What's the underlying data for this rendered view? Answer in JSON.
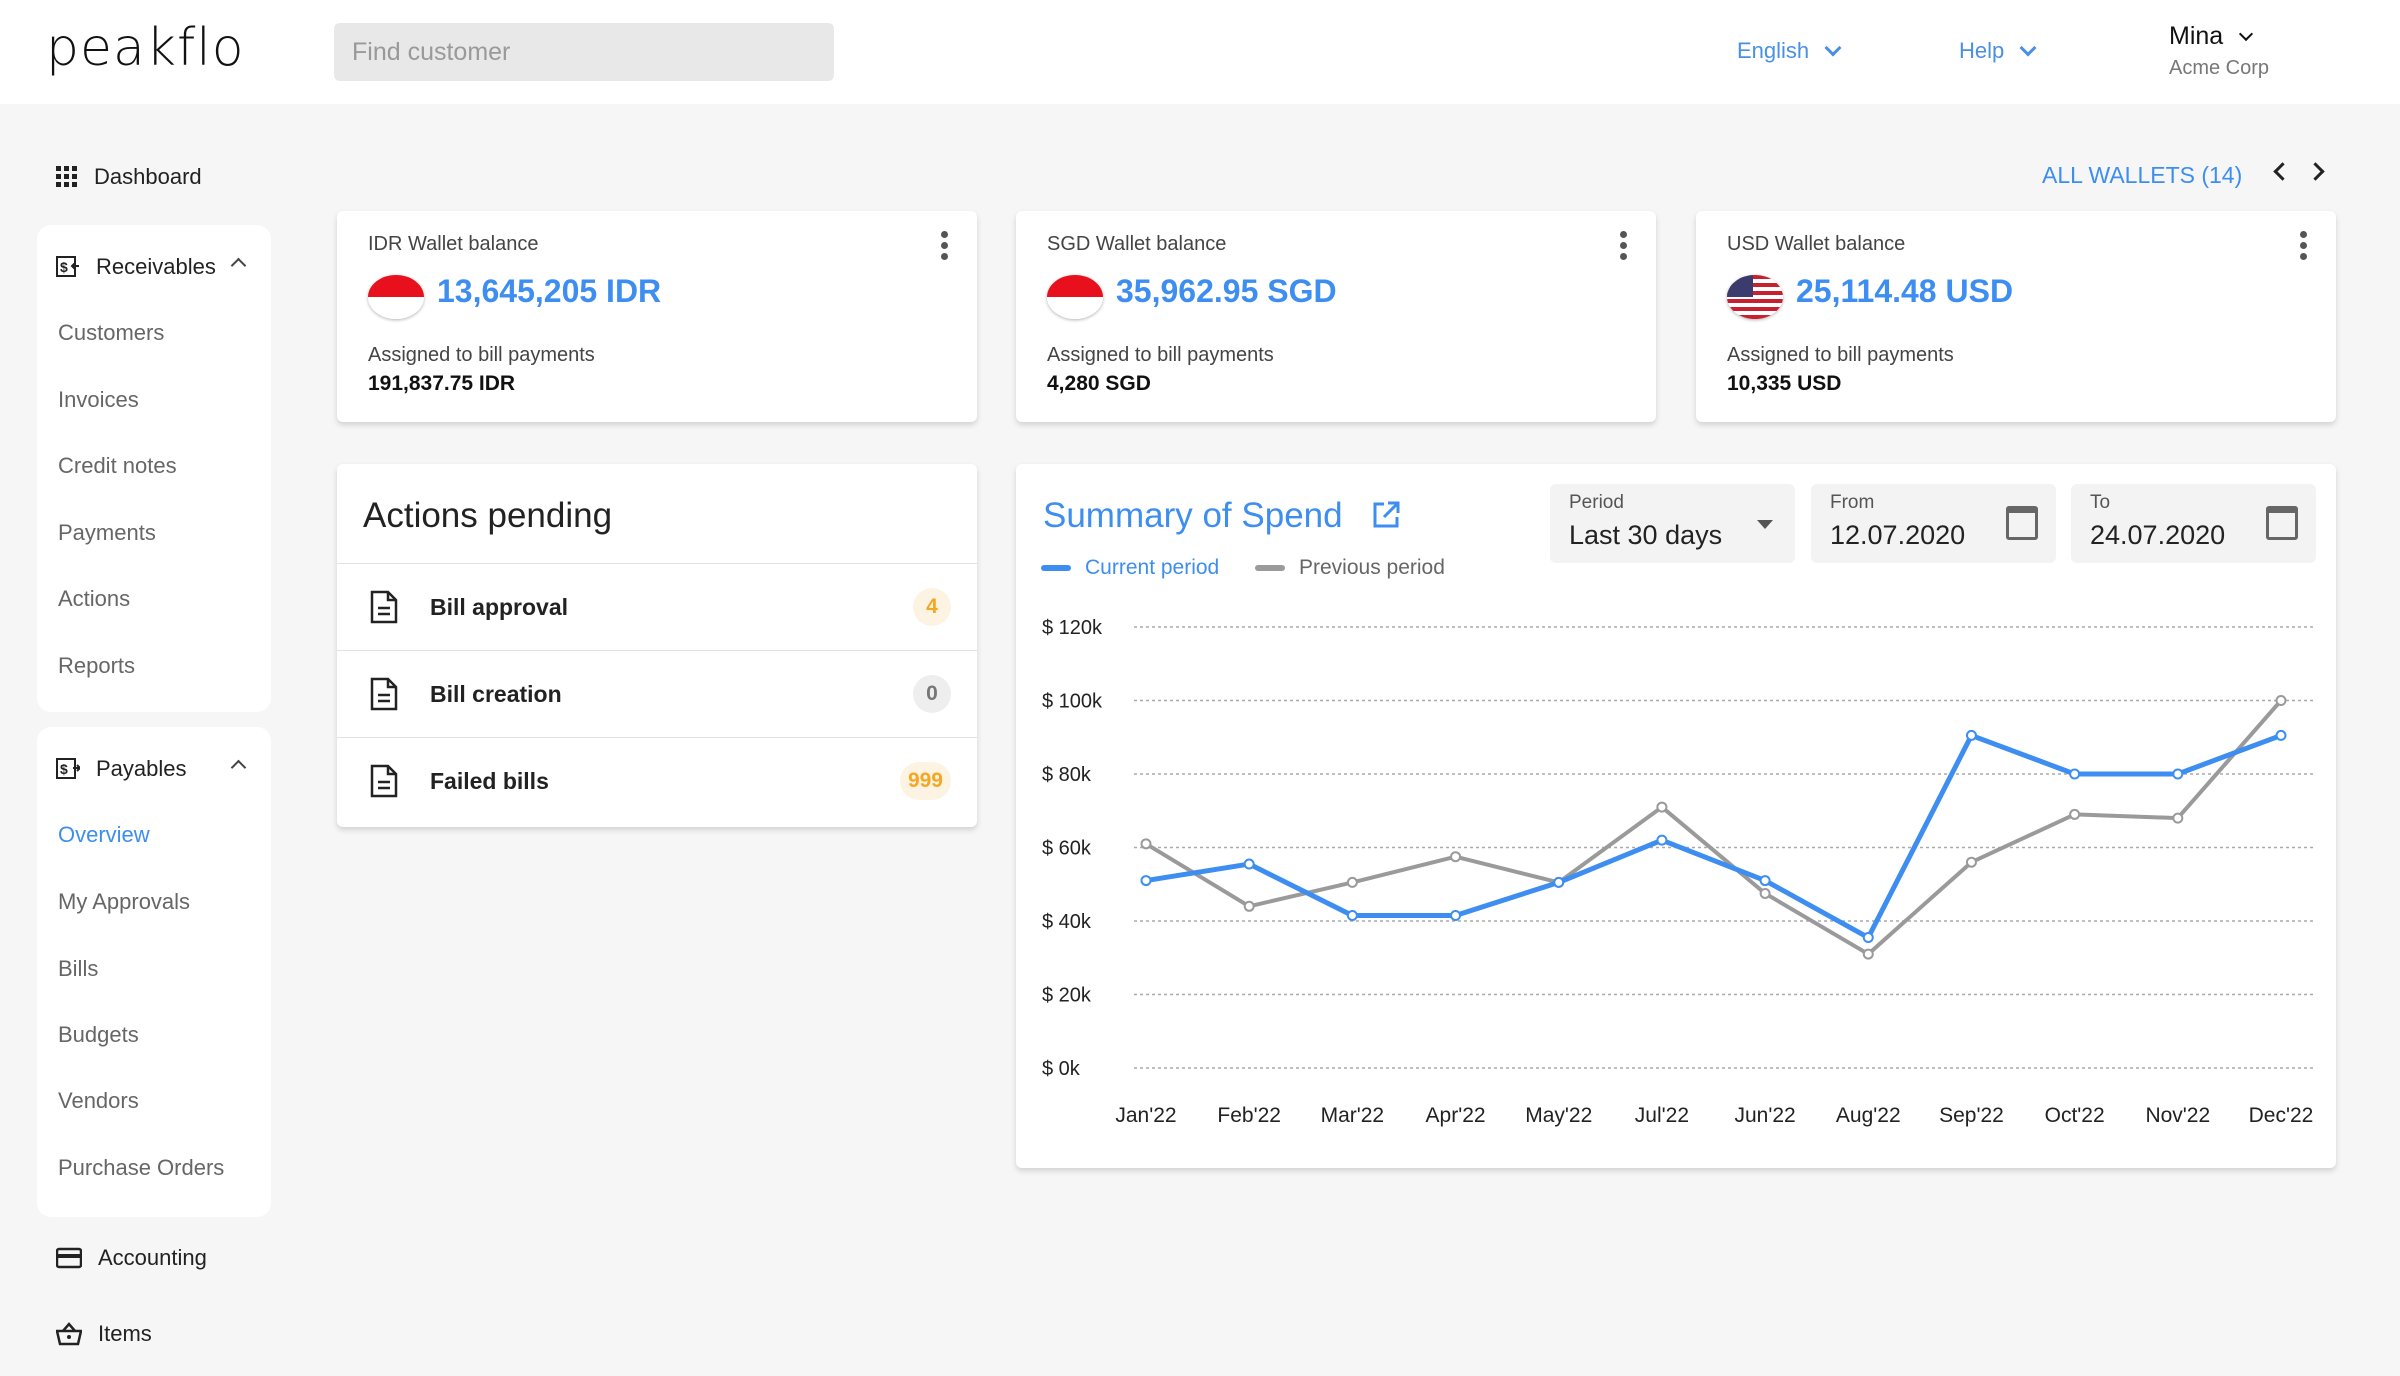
{
  "header": {
    "logo": "peakflo",
    "search_placeholder": "Find customer",
    "language": "English",
    "help": "Help",
    "user_name": "Mina",
    "company": "Acme Corp"
  },
  "sidebar": {
    "dashboard": "Dashboard",
    "receivables": {
      "label": "Receivables",
      "items": [
        "Customers",
        "Invoices",
        "Credit notes",
        "Payments",
        "Actions",
        "Reports"
      ]
    },
    "payables": {
      "label": "Payables",
      "items": [
        "Overview",
        "My Approvals",
        "Bills",
        "Budgets",
        "Vendors",
        "Purchase Orders"
      ],
      "active": "Overview"
    },
    "accounting": "Accounting",
    "items_label": "Items"
  },
  "wallets": {
    "all_label": "ALL WALLETS (14)",
    "cards": [
      {
        "label": "IDR Wallet balance",
        "amount": "13,645,205 IDR",
        "sub_label": "Assigned to bill payments",
        "sub_value": "191,837.75 IDR",
        "flag": "indonesia"
      },
      {
        "label": "SGD Wallet balance",
        "amount": "35,962.95 SGD",
        "sub_label": "Assigned to bill payments",
        "sub_value": "4,280 SGD",
        "flag": "singapore"
      },
      {
        "label": "USD Wallet balance",
        "amount": "25,114.48 USD",
        "sub_label": "Assigned to bill payments",
        "sub_value": "10,335 USD",
        "flag": "usa"
      }
    ]
  },
  "actions": {
    "title": "Actions pending",
    "rows": [
      {
        "label": "Bill approval",
        "count": "4",
        "badge_bg": "#fdf3e2",
        "badge_color": "#f5a623"
      },
      {
        "label": "Bill creation",
        "count": "0",
        "badge_bg": "#eeeeee",
        "badge_color": "#777777"
      },
      {
        "label": "Failed bills",
        "count": "999",
        "badge_bg": "#fdf3e2",
        "badge_color": "#f5a623"
      }
    ]
  },
  "summary": {
    "title": "Summary of Spend",
    "period": {
      "label": "Period",
      "value": "Last 30 days"
    },
    "from": {
      "label": "From",
      "value": "12.07.2020"
    },
    "to": {
      "label": "To",
      "value": "24.07.2020"
    }
  },
  "colors": {
    "accent": "#3d8ef0",
    "previous": "#9a9a9a"
  },
  "chart_data": {
    "type": "line",
    "categories": [
      "Jan'22",
      "Feb'22",
      "Mar'22",
      "Apr'22",
      "May'22",
      "Jul'22",
      "Jun'22",
      "Aug'22",
      "Sep'22",
      "Oct'22",
      "Nov'22",
      "Dec'22"
    ],
    "series": [
      {
        "name": "Current period",
        "values": [
          51000,
          55500,
          41500,
          41500,
          50500,
          62000,
          51000,
          35500,
          90500,
          80000,
          80000,
          90500
        ],
        "color": "#3d8ef0"
      },
      {
        "name": "Previous period",
        "values": [
          61000,
          44000,
          50500,
          57500,
          50500,
          71000,
          47500,
          31000,
          56000,
          69000,
          68000,
          100000
        ],
        "color": "#9a9a9a"
      }
    ],
    "yticks": [
      "$ 0k",
      "$ 20k",
      "$ 40k",
      "$ 60k",
      "$ 80k",
      "$ 100k",
      "$ 120k"
    ],
    "ylim": [
      0,
      120000
    ],
    "grid": true,
    "legend": "top-left"
  }
}
